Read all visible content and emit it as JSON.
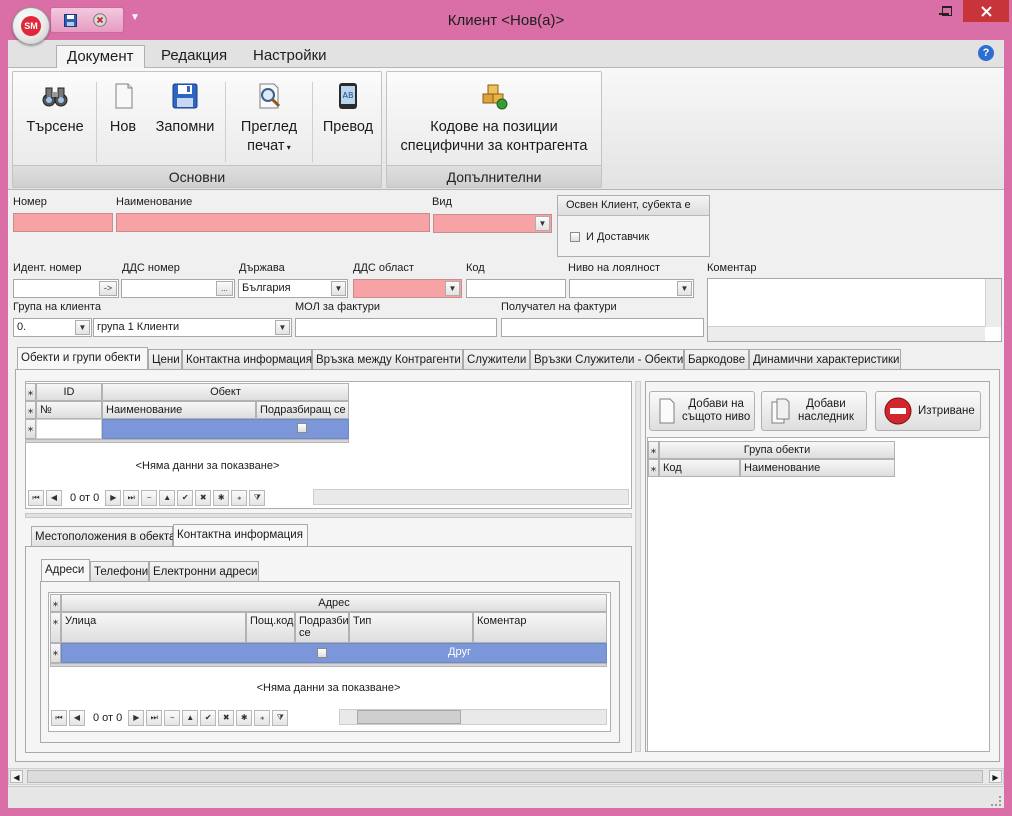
{
  "window": {
    "title": "Клиент <Нов(а)>",
    "logo_text": "SM"
  },
  "ribbon": {
    "tabs": [
      "Документ",
      "Редакция",
      "Настройки"
    ],
    "groups": {
      "main": {
        "caption": "Основни",
        "buttons": {
          "search": "Търсене",
          "new": "Нов",
          "save": "Запомни",
          "preview_line1": "Преглед",
          "preview_line2": "печат",
          "translate": "Превод"
        }
      },
      "additional": {
        "caption": "Допълнителни",
        "buttons": {
          "codes_line1": "Кодове на позиции",
          "codes_line2": "специфични за контрагента"
        }
      }
    }
  },
  "form": {
    "labels": {
      "number": "Номер",
      "name": "Наименование",
      "type": "Вид",
      "ident_number": "Идент. номер",
      "vat_number": "ДДС номер",
      "country": "Държава",
      "vat_area": "ДДС област",
      "code": "Код",
      "loyalty_level": "Ниво на лоялност",
      "comment": "Коментар",
      "client_group": "Група на клиента",
      "invoice_mol": "МОЛ за фактури",
      "invoice_receiver": "Получател на фактури"
    },
    "values": {
      "number": "",
      "name": "",
      "type": "",
      "ident_number": "",
      "ident_button": "->",
      "vat_number": "",
      "vat_button": "...",
      "country": "България",
      "vat_area": "",
      "code": "",
      "loyalty_level": "",
      "client_group_code": "0.",
      "client_group_name": "група 1 Клиенти",
      "invoice_mol": "",
      "invoice_receiver": "",
      "comment": ""
    },
    "except_box": {
      "title": "Освен Клиент, субекта е",
      "checkbox_label": "И Доставчик",
      "checked": false
    }
  },
  "tabs": {
    "main": [
      "Обекти и групи обекти",
      "Цени",
      "Контактна информация",
      "Връзка между Контрагенти",
      "Служители",
      "Връзки Служители - Обекти",
      "Баркодове",
      "Динамични характеристики"
    ],
    "active_index": 0
  },
  "objects_grid": {
    "band_headers": [
      "ID",
      "Обект"
    ],
    "columns": [
      "№",
      "Наименование",
      "Подразбиращ се"
    ],
    "empty_text": "<Няма данни за показване>",
    "nav_text": "0 от 0"
  },
  "sub_tabs": {
    "items": [
      "Местоположения в обекта",
      "Контактна информация"
    ],
    "active_index": 1
  },
  "contact_tabs": {
    "items": [
      "Адреси",
      "Телефони",
      "Електронни адреси"
    ],
    "active_index": 0
  },
  "address_grid": {
    "band_header": "Адрес",
    "columns": [
      "Улица",
      "Пощ.код",
      "Подразбиращ се",
      "Тип",
      "Коментар"
    ],
    "new_row_type": "Друг",
    "empty_text": "<Няма данни за показване>",
    "nav_text": "0 от 0"
  },
  "group_panel": {
    "buttons": {
      "add_same_level_line1": "Добави на",
      "add_same_level_line2": "същото ниво",
      "add_child_line1": "Добави",
      "add_child_line2": "наследник",
      "delete": "Изтриване"
    },
    "grid": {
      "band_header": "Група обекти",
      "columns": [
        "Код",
        "Наименование"
      ]
    }
  },
  "colors": {
    "window_frame": "#d96fa6",
    "required_field": "#f7a3a6",
    "selected_row": "#7b97d9",
    "close_button": "#c7343a"
  },
  "icons": [
    "binoculars-icon",
    "new-document-icon",
    "save-disk-icon",
    "print-preview-icon",
    "translate-icon",
    "boxes-icon",
    "delete-icon",
    "help-icon"
  ]
}
